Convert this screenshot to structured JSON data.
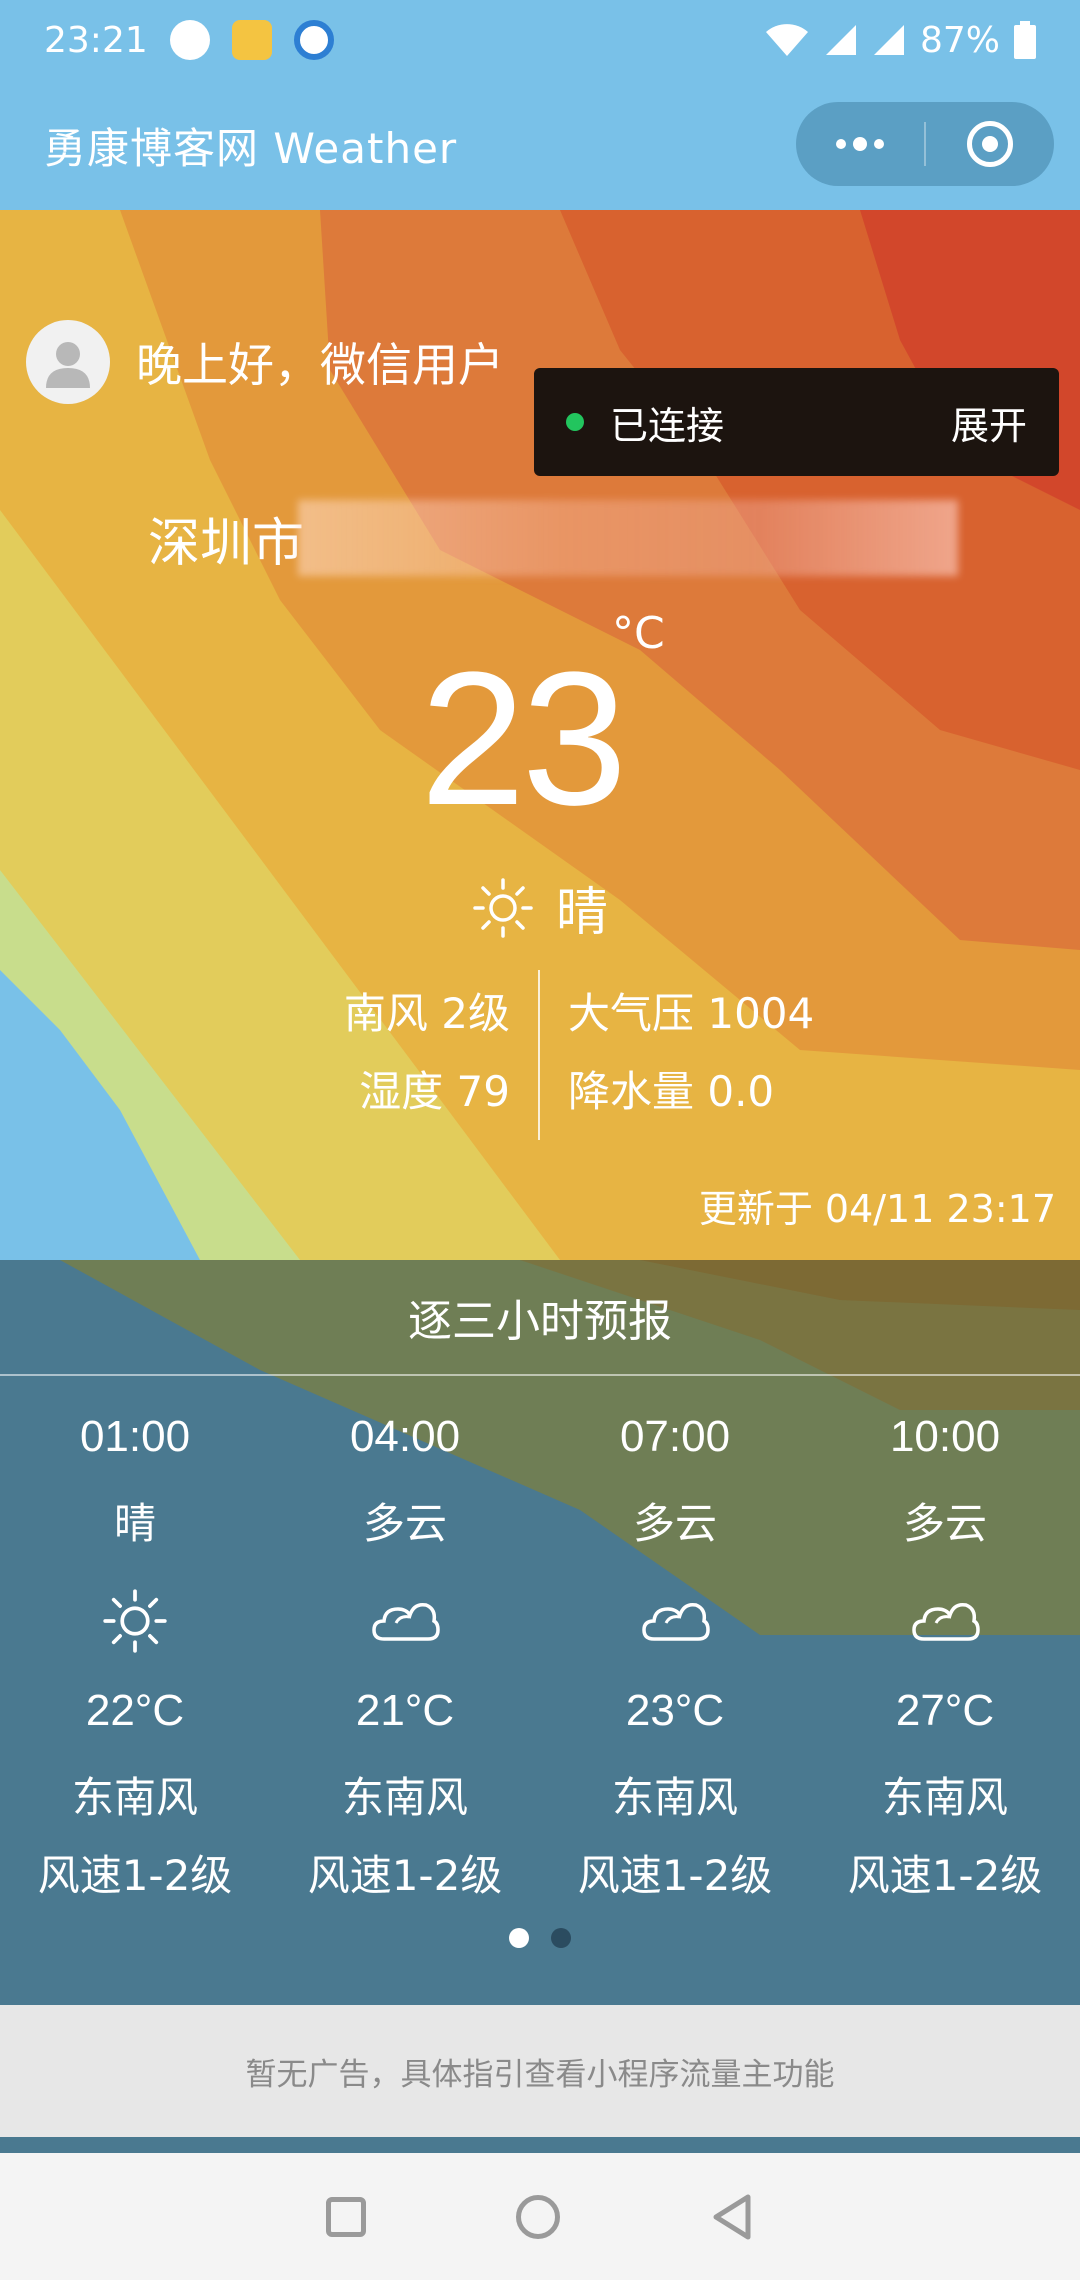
{
  "status_bar": {
    "time": "23:21",
    "battery": "87%",
    "icons": [
      "message-icon",
      "app-icon",
      "app-icon",
      "wifi-icon",
      "signal-icon",
      "signal-icon",
      "battery-icon"
    ]
  },
  "title_bar": {
    "title": "勇康博客网 Weather",
    "menu_icon": "more-dots-icon",
    "close_icon": "target-icon"
  },
  "header": {
    "greeting": "晚上好，微信用户",
    "connection_status": "已连接",
    "expand_label": "展开",
    "city": "深圳市"
  },
  "current": {
    "temperature": "23",
    "unit": "°C",
    "condition": "晴",
    "wind": "南风 2级",
    "pressure": "大气压 1004",
    "humidity": "湿度 79",
    "precipitation": "降水量 0.0",
    "updated": "更新于 04/11 23:17"
  },
  "forecast": {
    "title": "逐三小时预报",
    "items": [
      {
        "time": "01:00",
        "condition": "晴",
        "icon": "sun-icon",
        "temp": "22°C",
        "wind": "东南风",
        "speed": "风速1-2级"
      },
      {
        "time": "04:00",
        "condition": "多云",
        "icon": "cloud-icon",
        "temp": "21°C",
        "wind": "东南风",
        "speed": "风速1-2级"
      },
      {
        "time": "07:00",
        "condition": "多云",
        "icon": "cloud-icon",
        "temp": "23°C",
        "wind": "东南风",
        "speed": "风速1-2级"
      },
      {
        "time": "10:00",
        "condition": "多云",
        "icon": "cloud-icon",
        "temp": "27°C",
        "wind": "东南风",
        "speed": "风速1-2级"
      }
    ],
    "page_current": 1,
    "page_total": 2
  },
  "ad": {
    "text": "暂无广告，具体指引查看小程序流量主功能"
  },
  "colors": {
    "sky": "#79c1e8",
    "forecast_bg": "#4a7990",
    "orange": "#e0822f",
    "red": "#d9472a",
    "yellow": "#e8c84e"
  }
}
